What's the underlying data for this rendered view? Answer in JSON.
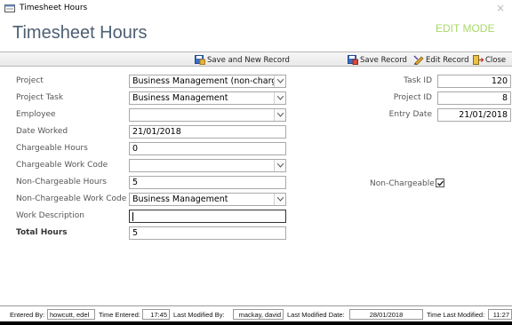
{
  "window": {
    "title": "Timesheet Hours",
    "close_glyph": "×"
  },
  "header": {
    "form_title": "Timesheet Hours",
    "mode": "EDIT MODE",
    "mode_color": "#a8d86a"
  },
  "toolbar": {
    "save_new": "Save and New Record",
    "save": "Save Record",
    "edit": "Edit Record",
    "close": "Close"
  },
  "form": {
    "project": {
      "label": "Project",
      "value": "Business Management (non-charge)"
    },
    "project_task": {
      "label": "Project Task",
      "value": "Business Management"
    },
    "employee": {
      "label": "Employee",
      "value": ""
    },
    "date_worked": {
      "label": "Date Worked",
      "value": "21/01/2018"
    },
    "chargeable_hours": {
      "label": "Chargeable Hours",
      "value": "0"
    },
    "chargeable_work_code": {
      "label": "Chargeable Work Code",
      "value": ""
    },
    "non_chargeable_hours": {
      "label": "Non-Chargeable Hours",
      "value": "5"
    },
    "non_chargeable_work_code": {
      "label": "Non-Chargeable Work Code",
      "value": "Business Management"
    },
    "work_description": {
      "label": "Work Description",
      "value": ""
    },
    "total_hours": {
      "label": "Total Hours",
      "value": "5"
    },
    "task_id": {
      "label": "Task ID",
      "value": "120"
    },
    "project_id": {
      "label": "Project ID",
      "value": "8"
    },
    "entry_date": {
      "label": "Entry Date",
      "value": "21/01/2018"
    },
    "non_chargeable": {
      "label": "Non-Chargeable",
      "checked": true
    }
  },
  "status": {
    "entered_by_label": "Entered By:",
    "entered_by": "howcutt, edel",
    "time_entered_label": "Time Entered:",
    "time_entered": "17:45",
    "last_modified_by_label": "Last Modified By:",
    "last_modified_by": "mackay, david",
    "last_modified_date_label": "Last Modified Date:",
    "last_modified_date": "28/01/2018",
    "time_last_modified_label": "Time Last Modified:",
    "time_last_modified": "11:27"
  }
}
